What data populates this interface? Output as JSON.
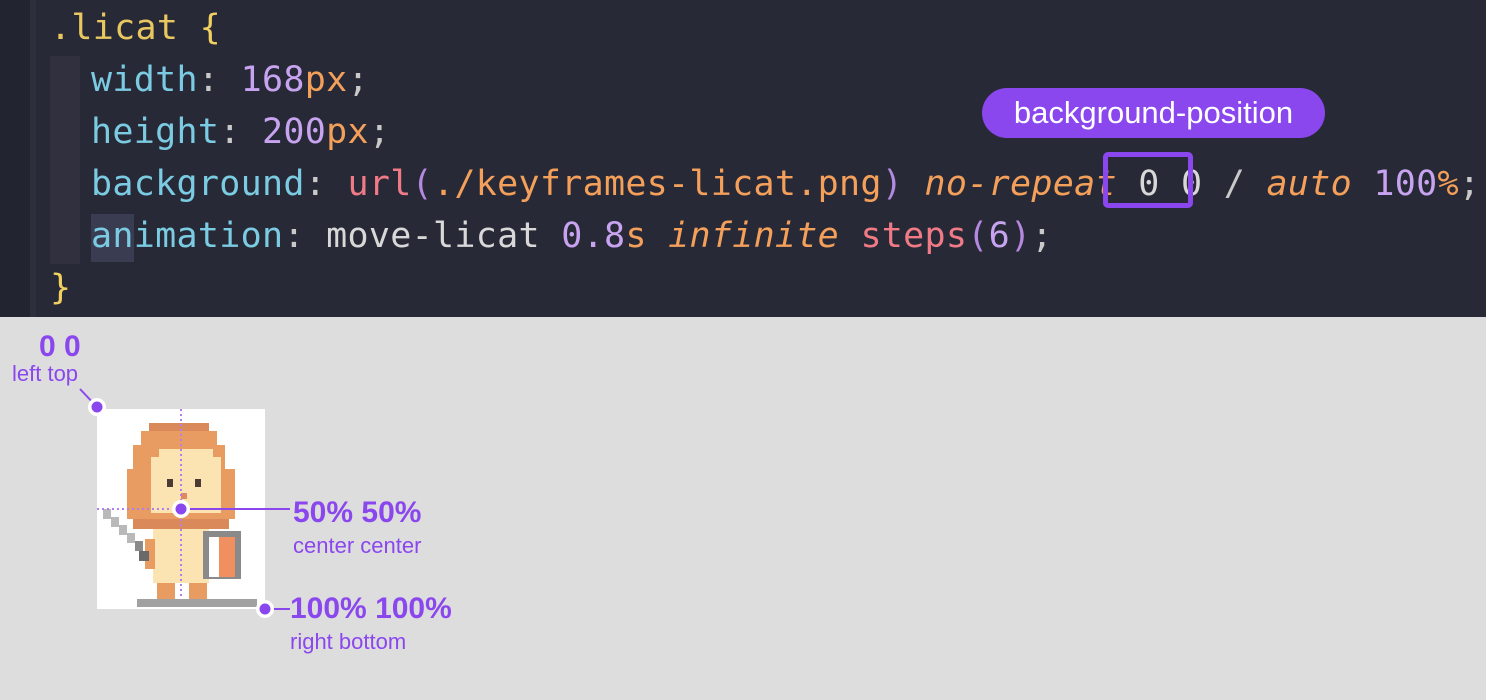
{
  "code": {
    "selector": ".licat",
    "open_brace": "{",
    "close_brace": "}",
    "width_prop": "width",
    "width_value": "168",
    "width_unit": "px",
    "height_prop": "height",
    "height_value": "200",
    "height_unit": "px",
    "background_prop": "background",
    "url_fn": "url",
    "url_arg": "./keyframes-licat.png",
    "no_repeat": "no-repeat",
    "position_value": "0 0",
    "slash": "/",
    "size_auto": "auto",
    "size_value": "100",
    "size_unit": "%",
    "animation_prop": "animation",
    "animation_name": "move-licat",
    "duration_value": "0.8",
    "duration_unit": "s",
    "iteration": "infinite",
    "steps_fn": "steps",
    "steps_count": "6"
  },
  "callout": {
    "label": "background-position"
  },
  "diagram": {
    "top_left": {
      "value": "0 0",
      "label": "left top"
    },
    "center": {
      "value": "50% 50%",
      "label": "center center"
    },
    "bottom_right": {
      "value": "100% 100%",
      "label": "right bottom"
    },
    "accent_color": "#8b47ee"
  }
}
